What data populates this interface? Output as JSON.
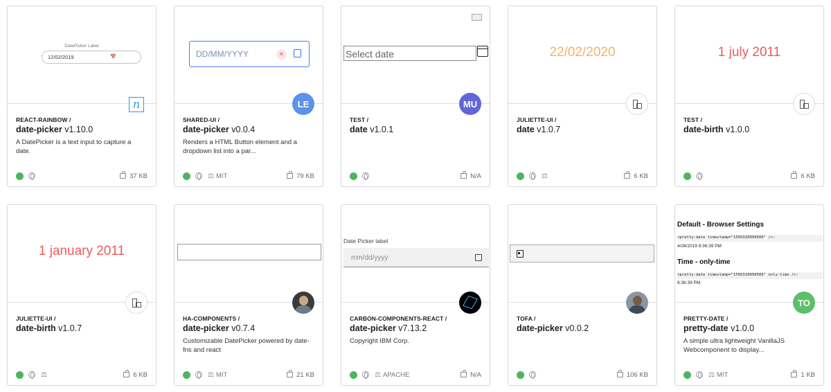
{
  "colors": {
    "status_green": "#4cb55d",
    "juliette_orange": "#f4b16a",
    "date_red": "#ee5a5a",
    "avatar_le": "#5b93ea",
    "avatar_mu": "#6165d8",
    "avatar_to": "#5cbf6a"
  },
  "cards": [
    {
      "scope": "REACT-RAINBOW /",
      "name": "date-picker",
      "version": "v1.10.0",
      "description": "A DatePicker is a text input to capture a date.",
      "license": "",
      "size": "37 KB",
      "preview": {
        "label": "DatePicker Label",
        "value": "12/02/2019"
      },
      "avatar_icon": "react-rainbow-logo",
      "avatar_text": "n"
    },
    {
      "scope": "SHARED-UI /",
      "name": "date-picker",
      "version": "v0.0.4",
      "description": "Renders a HTML Button element and a dropdown list into a par...",
      "license": "MIT",
      "size": "79 KB",
      "preview": {
        "placeholder": "DD/MM/YYYY",
        "clear": "✕"
      },
      "avatar_text": "LE"
    },
    {
      "scope": "TEST /",
      "name": "date",
      "version": "v1.0.1",
      "description": "",
      "license": "",
      "size": "N/A",
      "preview": {
        "placeholder": "Select date"
      },
      "avatar_text": "MU"
    },
    {
      "scope": "JULIETTE-UI /",
      "name": "date",
      "version": "v1.0.7",
      "description": "",
      "license": "",
      "size": "6 KB",
      "preview": {
        "text": "22/02/2020"
      },
      "avatar_icon": "building-icon"
    },
    {
      "scope": "TEST /",
      "name": "date-birth",
      "version": "v1.0.0",
      "description": "",
      "license": "",
      "size": "6 KB",
      "preview": {
        "text": "1 july 2011"
      },
      "avatar_icon": "building-icon"
    },
    {
      "scope": "JULIETTE-UI /",
      "name": "date-birth",
      "version": "v1.0.7",
      "description": "",
      "license": "",
      "size": "6 KB",
      "preview": {
        "text": "1 january 2011"
      },
      "avatar_icon": "building-icon"
    },
    {
      "scope": "HA-COMPONENTS /",
      "name": "date-picker",
      "version": "v0.7.4",
      "description": "Customizable DatePicker powered by date-fns and react",
      "license": "MIT",
      "size": "21 KB",
      "preview": {},
      "avatar_icon": "user-photo"
    },
    {
      "scope": "CARBON-COMPONENTS-REACT /",
      "name": "date-picker",
      "version": "v7.13.2",
      "description": "Copyright IBM Corp.",
      "license": "APACHE",
      "size": "N/A",
      "preview": {
        "label": "Date Picker label",
        "placeholder": "mm/dd/yyyy"
      },
      "avatar_icon": "carbon-logo"
    },
    {
      "scope": "TOFA /",
      "name": "date-picker",
      "version": "v0.0.2",
      "description": "",
      "license": "",
      "size": "106 KB",
      "preview": {},
      "avatar_icon": "user-photo"
    },
    {
      "scope": "PRETTY-DATE /",
      "name": "pretty-date",
      "version": "v1.0.0",
      "description": "A simple ultra lightweight VanillaJS Webcomponent to display...",
      "license": "MIT",
      "size": "1 KB",
      "preview": {
        "heading1": "Default - Browser Settings",
        "code1": "<pretty-date timestamp=\"1556310999589\" />:",
        "out1": "4/26/2019 8:36:39 PM",
        "heading2": "Time - only-time",
        "code2": "<pretty-date timestamp=\"1556310999589\" only-time />:",
        "out2": "8:36:39 PM"
      },
      "avatar_text": "TO"
    }
  ]
}
